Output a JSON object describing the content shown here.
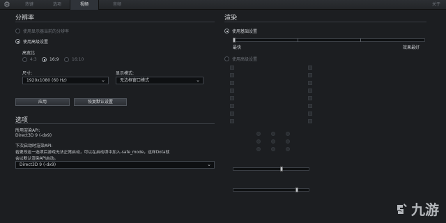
{
  "tabs": [
    {
      "label": "热键"
    },
    {
      "label": "选项"
    },
    {
      "label": "视频"
    },
    {
      "label": "音频"
    }
  ],
  "close_label": "关于",
  "resolution": {
    "title": "分辨率",
    "option_desktop": "使用显示器当前的分辨率",
    "option_advanced": "使用高级设置",
    "aspect_label": "高宽比",
    "aspect_options": [
      "4:3",
      "16:9",
      "16:10"
    ],
    "size_label": "尺寸:",
    "size_value": "1920x1080 (60 Hz)",
    "display_mode_label": "显示模式:",
    "display_mode_value": "无边框窗口模式",
    "apply_button": "应用",
    "reset_button": "恢复默认设置"
  },
  "options": {
    "title": "选项",
    "api_label": "所用渲染API:",
    "api_value": "Direct3D 9 (-dx9)",
    "next_launch_label": "下次启动时渲染API:",
    "note_line1": "若更改这一选项后游戏无法正常启动，可以在启动项中加入-safe_mode，这样Dota就",
    "note_line2": "会以默认渲染API启动。",
    "api_select_value": "Direct3D 9 (-dx9)"
  },
  "render": {
    "title": "渲染",
    "option_basic": "使用基础设置",
    "slider_left": "最快",
    "slider_right": "效果最好",
    "option_advanced": "使用高级设置"
  },
  "colors": {
    "background": "#1c1e21",
    "active_tab": "#2f3339",
    "text": "#c9ccd0"
  },
  "watermark": {
    "text": "九游",
    "icon": "jiuyou-logo-icon"
  }
}
